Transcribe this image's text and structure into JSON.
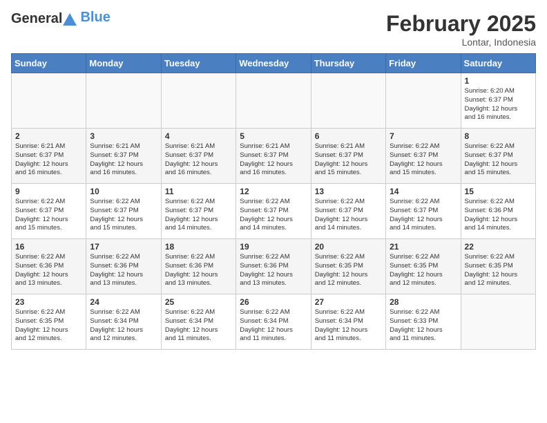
{
  "logo": {
    "general": "General",
    "blue": "Blue"
  },
  "header": {
    "month": "February 2025",
    "location": "Lontar, Indonesia"
  },
  "days_of_week": [
    "Sunday",
    "Monday",
    "Tuesday",
    "Wednesday",
    "Thursday",
    "Friday",
    "Saturday"
  ],
  "weeks": [
    [
      {
        "day": "",
        "info": ""
      },
      {
        "day": "",
        "info": ""
      },
      {
        "day": "",
        "info": ""
      },
      {
        "day": "",
        "info": ""
      },
      {
        "day": "",
        "info": ""
      },
      {
        "day": "",
        "info": ""
      },
      {
        "day": "1",
        "info": "Sunrise: 6:20 AM\nSunset: 6:37 PM\nDaylight: 12 hours\nand 16 minutes."
      }
    ],
    [
      {
        "day": "2",
        "info": "Sunrise: 6:21 AM\nSunset: 6:37 PM\nDaylight: 12 hours\nand 16 minutes."
      },
      {
        "day": "3",
        "info": "Sunrise: 6:21 AM\nSunset: 6:37 PM\nDaylight: 12 hours\nand 16 minutes."
      },
      {
        "day": "4",
        "info": "Sunrise: 6:21 AM\nSunset: 6:37 PM\nDaylight: 12 hours\nand 16 minutes."
      },
      {
        "day": "5",
        "info": "Sunrise: 6:21 AM\nSunset: 6:37 PM\nDaylight: 12 hours\nand 16 minutes."
      },
      {
        "day": "6",
        "info": "Sunrise: 6:21 AM\nSunset: 6:37 PM\nDaylight: 12 hours\nand 15 minutes."
      },
      {
        "day": "7",
        "info": "Sunrise: 6:22 AM\nSunset: 6:37 PM\nDaylight: 12 hours\nand 15 minutes."
      },
      {
        "day": "8",
        "info": "Sunrise: 6:22 AM\nSunset: 6:37 PM\nDaylight: 12 hours\nand 15 minutes."
      }
    ],
    [
      {
        "day": "9",
        "info": "Sunrise: 6:22 AM\nSunset: 6:37 PM\nDaylight: 12 hours\nand 15 minutes."
      },
      {
        "day": "10",
        "info": "Sunrise: 6:22 AM\nSunset: 6:37 PM\nDaylight: 12 hours\nand 15 minutes."
      },
      {
        "day": "11",
        "info": "Sunrise: 6:22 AM\nSunset: 6:37 PM\nDaylight: 12 hours\nand 14 minutes."
      },
      {
        "day": "12",
        "info": "Sunrise: 6:22 AM\nSunset: 6:37 PM\nDaylight: 12 hours\nand 14 minutes."
      },
      {
        "day": "13",
        "info": "Sunrise: 6:22 AM\nSunset: 6:37 PM\nDaylight: 12 hours\nand 14 minutes."
      },
      {
        "day": "14",
        "info": "Sunrise: 6:22 AM\nSunset: 6:37 PM\nDaylight: 12 hours\nand 14 minutes."
      },
      {
        "day": "15",
        "info": "Sunrise: 6:22 AM\nSunset: 6:36 PM\nDaylight: 12 hours\nand 14 minutes."
      }
    ],
    [
      {
        "day": "16",
        "info": "Sunrise: 6:22 AM\nSunset: 6:36 PM\nDaylight: 12 hours\nand 13 minutes."
      },
      {
        "day": "17",
        "info": "Sunrise: 6:22 AM\nSunset: 6:36 PM\nDaylight: 12 hours\nand 13 minutes."
      },
      {
        "day": "18",
        "info": "Sunrise: 6:22 AM\nSunset: 6:36 PM\nDaylight: 12 hours\nand 13 minutes."
      },
      {
        "day": "19",
        "info": "Sunrise: 6:22 AM\nSunset: 6:36 PM\nDaylight: 12 hours\nand 13 minutes."
      },
      {
        "day": "20",
        "info": "Sunrise: 6:22 AM\nSunset: 6:35 PM\nDaylight: 12 hours\nand 12 minutes."
      },
      {
        "day": "21",
        "info": "Sunrise: 6:22 AM\nSunset: 6:35 PM\nDaylight: 12 hours\nand 12 minutes."
      },
      {
        "day": "22",
        "info": "Sunrise: 6:22 AM\nSunset: 6:35 PM\nDaylight: 12 hours\nand 12 minutes."
      }
    ],
    [
      {
        "day": "23",
        "info": "Sunrise: 6:22 AM\nSunset: 6:35 PM\nDaylight: 12 hours\nand 12 minutes."
      },
      {
        "day": "24",
        "info": "Sunrise: 6:22 AM\nSunset: 6:34 PM\nDaylight: 12 hours\nand 12 minutes."
      },
      {
        "day": "25",
        "info": "Sunrise: 6:22 AM\nSunset: 6:34 PM\nDaylight: 12 hours\nand 11 minutes."
      },
      {
        "day": "26",
        "info": "Sunrise: 6:22 AM\nSunset: 6:34 PM\nDaylight: 12 hours\nand 11 minutes."
      },
      {
        "day": "27",
        "info": "Sunrise: 6:22 AM\nSunset: 6:34 PM\nDaylight: 12 hours\nand 11 minutes."
      },
      {
        "day": "28",
        "info": "Sunrise: 6:22 AM\nSunset: 6:33 PM\nDaylight: 12 hours\nand 11 minutes."
      },
      {
        "day": "",
        "info": ""
      }
    ]
  ]
}
